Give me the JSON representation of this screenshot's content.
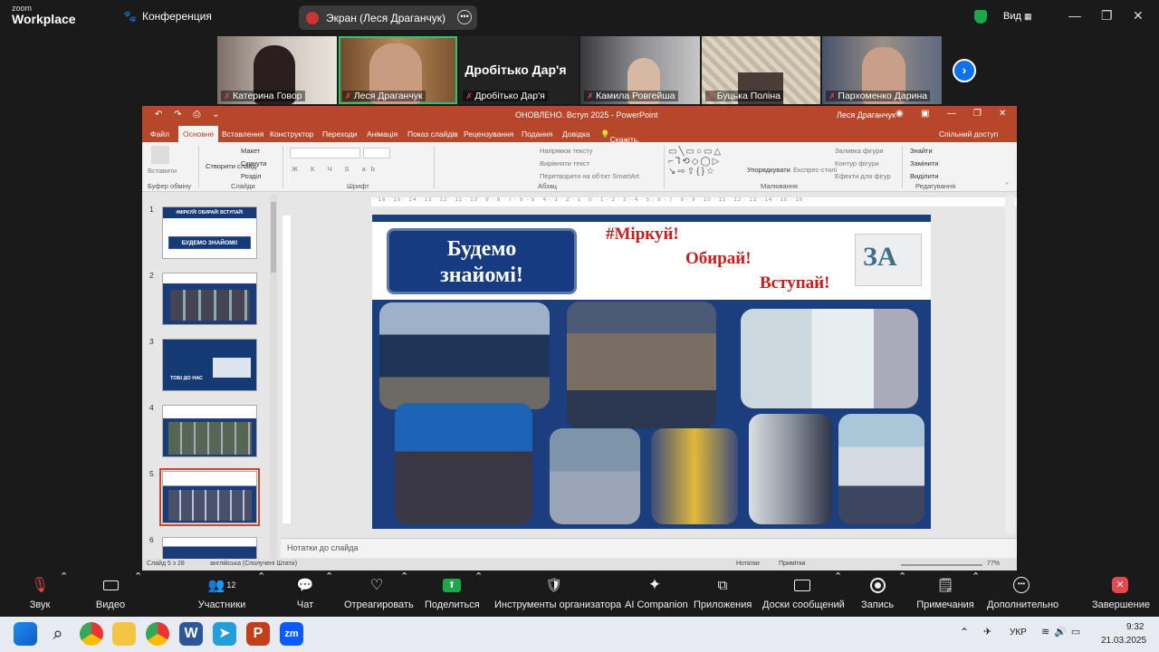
{
  "top": {
    "logo_small": "zoom",
    "logo_big": "Workplace",
    "meeting_label": "Конференция",
    "share_label": "Экран (Леся Драганчук)",
    "view_label": "Вид"
  },
  "participants": [
    "Катерина Говор",
    "Леся Драганчук",
    "Дробітько Дар'я",
    "Камила Ровгейша",
    "Буцька Поліна",
    "Пархоменко Дарина"
  ],
  "ppt": {
    "title": "ОНОВЛЕНО. Вступ 2025 - PowerPoint",
    "user": "Леся Драганчук",
    "tabs": [
      "Файл",
      "Основне",
      "Вставлення",
      "Конструктор",
      "Переходи",
      "Анімація",
      "Показ слайдів",
      "Рецензування",
      "Подання",
      "Довідка"
    ],
    "tell_me": "Скажіть, що потрібно зробити",
    "share": "Спільний доступ",
    "ribbon": {
      "paste": "Вставити",
      "clipboard": "Буфер обміну",
      "create_slide": "Створити слайд",
      "layout": "Макет",
      "reset": "Скинути",
      "section": "Розділ",
      "slides": "Слайди",
      "font": "Шрифт",
      "text_dir": "Напрямок тексту",
      "align_text": "Вирівняти текст",
      "smartart": "Перетворити на об'єкт SmartArt",
      "paragraph": "Абзац",
      "arrange": "Упорядкувати",
      "styles": "Експрес-стилі",
      "fill": "Заливка фігури",
      "outline": "Контур фігури",
      "effects": "Ефекти для фігур",
      "drawing": "Малювання",
      "find": "Знайти",
      "replace": "Замінити",
      "select": "Виділити",
      "editing": "Редагування"
    },
    "ruler": "· 16 · 15 · 14 · 13 · 12 · 11 · 10 · 9 · 8 · 7 · 6 · 5 · 4 · 3 · 2 · 1 · 0 · 1 · 2 · 3 · 4 · 5 · 6 · 7 · 8 · 9 · 10 · 11 · 12 · 13 · 14 · 15 · 16 ·",
    "notes": "Нотатки до слайда",
    "status_slide": "Слайд 5 з 28",
    "status_lang": "англійська (Сполучені Штати)",
    "status_notes": "Нотатки",
    "status_comments": "Примітки",
    "zoom": "77%"
  },
  "slides": [
    "1",
    "2",
    "3",
    "4",
    "5",
    "6"
  ],
  "thumbs": {
    "t1_header": "#МІРКУЙ! ОБИРАЙ! ВСТУПАЙ!",
    "t1_button": "БУДЕМО ЗНАЙОМІ!",
    "t3_text": "ТОБІ ДО НАС"
  },
  "slide": {
    "heading_line1": "Будемо",
    "heading_line2": "знайомі!",
    "slogan1": "#Міркуй!",
    "slogan2": "Обирай!",
    "slogan3": "Вступай!"
  },
  "toolbar": [
    "Звук",
    "Видео",
    "Участники",
    "Чат",
    "Отреагировать",
    "Поделиться",
    "Инструменты организатора",
    "AI Companion",
    "Приложения",
    "Доски сообщений",
    "Запись",
    "Примечания",
    "Дополнительно",
    "Завершение"
  ],
  "toolbar_participants_count": "12",
  "taskbar": {
    "lang": "УКР",
    "time": "9:32",
    "date": "21.03.2025"
  }
}
